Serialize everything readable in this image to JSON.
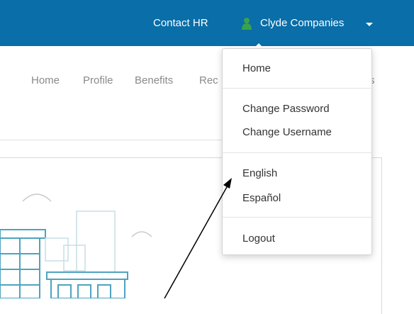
{
  "header": {
    "contact_label": "Contact HR",
    "company_label": "Clyde Companies",
    "bg_color": "#0a6ea8",
    "user_icon": "user-icon",
    "caret_icon": "caret-down-icon"
  },
  "nav": {
    "items": [
      {
        "label": "Home"
      },
      {
        "label": "Profile"
      },
      {
        "label": "Benefits"
      },
      {
        "label": "Rec"
      },
      {
        "label": "s"
      }
    ]
  },
  "dropdown": {
    "items": [
      {
        "label": "Home"
      },
      {
        "label": "Change Password"
      },
      {
        "label": "Change Username"
      },
      {
        "label": "English"
      },
      {
        "label": "Español"
      },
      {
        "label": "Logout"
      }
    ]
  }
}
